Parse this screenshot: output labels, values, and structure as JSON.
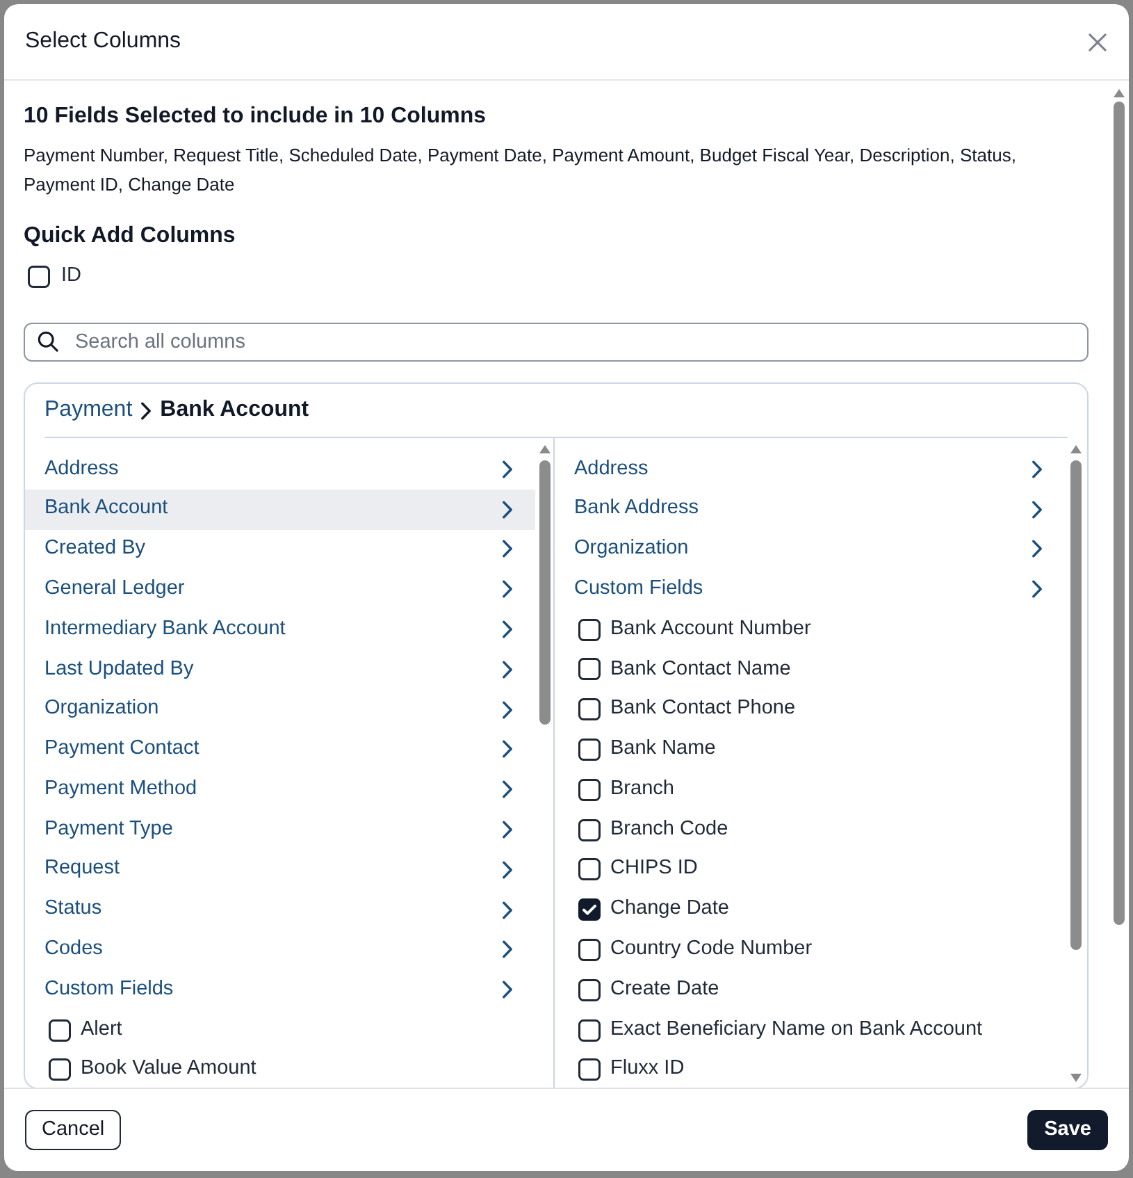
{
  "dialog": {
    "title": "Select Columns"
  },
  "summary": {
    "heading": "10 Fields Selected to include in 10 Columns",
    "fields": "Payment Number, Request Title, Scheduled Date, Payment Date, Payment Amount, Budget Fiscal Year, Description, Status, Payment ID, Change Date"
  },
  "quick_add": {
    "heading": "Quick Add Columns",
    "options": [
      {
        "label": "ID",
        "checked": false
      }
    ]
  },
  "search": {
    "placeholder": "Search all columns"
  },
  "breadcrumb": [
    {
      "label": "Payment",
      "current": false
    },
    {
      "label": "Bank Account",
      "current": true
    }
  ],
  "left_list": [
    {
      "kind": "group",
      "label": "Address",
      "selected": false
    },
    {
      "kind": "group",
      "label": "Bank Account",
      "selected": true
    },
    {
      "kind": "group",
      "label": "Created By",
      "selected": false
    },
    {
      "kind": "group",
      "label": "General Ledger",
      "selected": false
    },
    {
      "kind": "group",
      "label": "Intermediary Bank Account",
      "selected": false
    },
    {
      "kind": "group",
      "label": "Last Updated By",
      "selected": false
    },
    {
      "kind": "group",
      "label": "Organization",
      "selected": false
    },
    {
      "kind": "group",
      "label": "Payment Contact",
      "selected": false
    },
    {
      "kind": "group",
      "label": "Payment Method",
      "selected": false
    },
    {
      "kind": "group",
      "label": "Payment Type",
      "selected": false
    },
    {
      "kind": "group",
      "label": "Request",
      "selected": false
    },
    {
      "kind": "group",
      "label": "Status",
      "selected": false
    },
    {
      "kind": "group",
      "label": "Codes",
      "selected": false
    },
    {
      "kind": "group",
      "label": "Custom Fields",
      "selected": false
    },
    {
      "kind": "field",
      "label": "Alert",
      "checked": false
    },
    {
      "kind": "field",
      "label": "Book Value Amount",
      "checked": false
    }
  ],
  "right_list": [
    {
      "kind": "group",
      "label": "Address",
      "selected": false
    },
    {
      "kind": "group",
      "label": "Bank Address",
      "selected": false
    },
    {
      "kind": "group",
      "label": "Organization",
      "selected": false
    },
    {
      "kind": "group",
      "label": "Custom Fields",
      "selected": false
    },
    {
      "kind": "field",
      "label": "Bank Account Number",
      "checked": false
    },
    {
      "kind": "field",
      "label": "Bank Contact Name",
      "checked": false
    },
    {
      "kind": "field",
      "label": "Bank Contact Phone",
      "checked": false
    },
    {
      "kind": "field",
      "label": "Bank Name",
      "checked": false
    },
    {
      "kind": "field",
      "label": "Branch",
      "checked": false
    },
    {
      "kind": "field",
      "label": "Branch Code",
      "checked": false
    },
    {
      "kind": "field",
      "label": "CHIPS ID",
      "checked": false
    },
    {
      "kind": "field",
      "label": "Change Date",
      "checked": true
    },
    {
      "kind": "field",
      "label": "Country Code Number",
      "checked": false
    },
    {
      "kind": "field",
      "label": "Create Date",
      "checked": false
    },
    {
      "kind": "field",
      "label": "Exact Beneficiary Name on Bank Account",
      "checked": false
    },
    {
      "kind": "field",
      "label": "Fluxx ID",
      "checked": false
    }
  ],
  "buttons": [
    {
      "label": "Cancel",
      "kind": "secondary"
    },
    {
      "label": "Save",
      "kind": "primary"
    }
  ]
}
